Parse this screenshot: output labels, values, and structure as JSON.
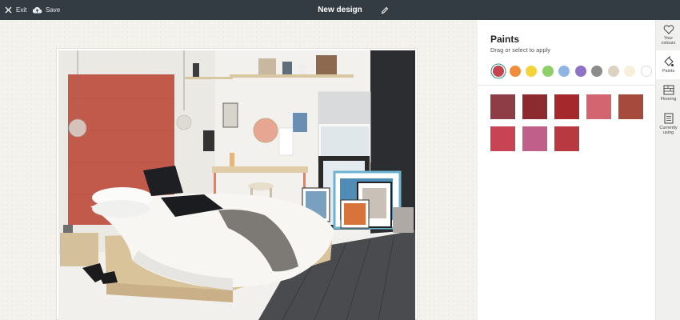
{
  "topbar": {
    "exit_label": "Exit",
    "save_label": "Save",
    "title": "New design",
    "exit_icon": "close-icon",
    "save_icon": "cloud-upload-icon",
    "edit_icon": "pencil-icon"
  },
  "panel": {
    "title": "Paints",
    "subtitle": "Drag or select to apply",
    "color_filters": [
      "#c4434f",
      "#f08c3a",
      "#f4d23c",
      "#8fcf6a",
      "#8fb6e2",
      "#8f72c6",
      "#8c8c8c",
      "#dcd2c2",
      "#f6efd9",
      "#ffffff"
    ],
    "selected_filter": "#c4434f",
    "swatches": [
      "#8e3c46",
      "#8d2a2f",
      "#a5282d",
      "#d36570",
      "#a74a3e",
      "#c84353",
      "#c0608a",
      "#b8393f"
    ]
  },
  "rail": [
    {
      "label": "Your colours",
      "icon": "heart-icon"
    },
    {
      "label": "Paints",
      "icon": "paint-roller-icon"
    },
    {
      "label": "Flooring",
      "icon": "flooring-icon"
    },
    {
      "label": "Currently using",
      "icon": "list-icon"
    }
  ],
  "colors": {
    "topbar": "#333c42",
    "panel": "#ffffff",
    "rail": "#f0f0ee",
    "accent_wall": "#c25a4c"
  }
}
